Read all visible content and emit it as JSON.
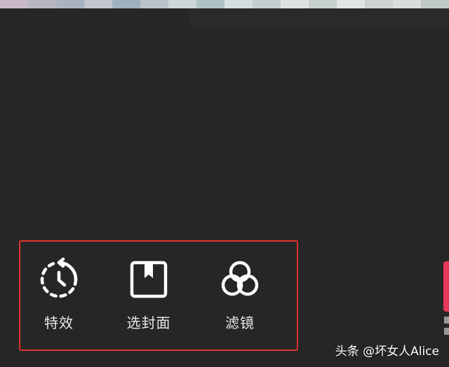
{
  "toolbar": {
    "items": [
      {
        "label": "特效",
        "icon": "effects-timer-icon"
      },
      {
        "label": "选封面",
        "icon": "cover-bookmark-icon"
      },
      {
        "label": "滤镜",
        "icon": "filter-circles-icon"
      }
    ],
    "highlight_color": "#e0352b"
  },
  "watermark": {
    "text": "头条 @坏女人Alice"
  },
  "colors": {
    "background": "#262626",
    "accent_pink": "#e8385a",
    "text": "#e8e8e8"
  }
}
